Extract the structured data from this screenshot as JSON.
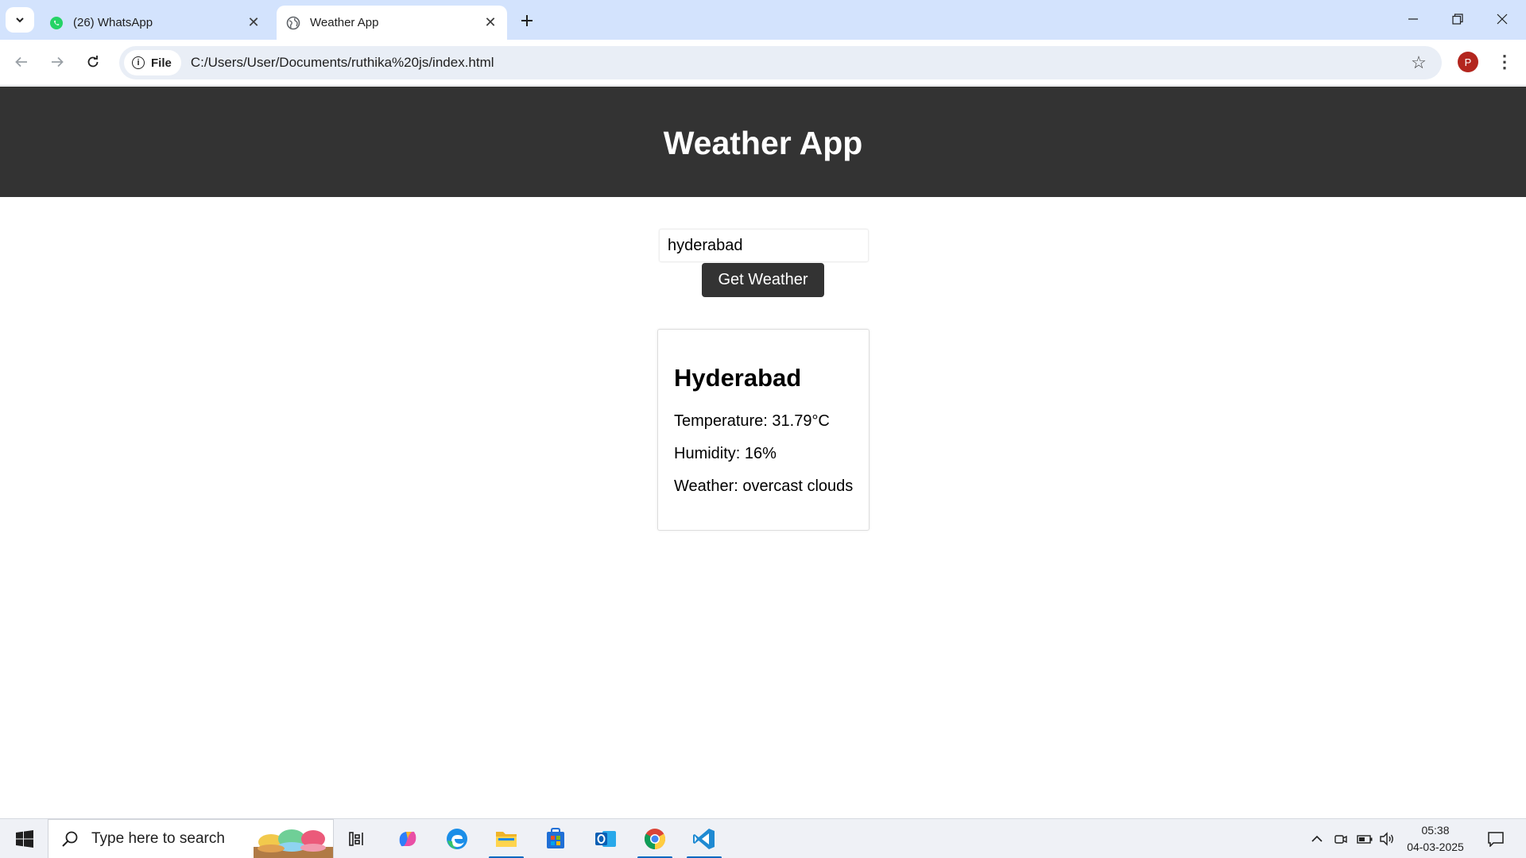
{
  "browser": {
    "tabs": [
      {
        "title": "(26) WhatsApp",
        "active": false,
        "icon": "whatsapp-icon"
      },
      {
        "title": "Weather App",
        "active": true,
        "icon": "globe-icon"
      }
    ],
    "address": {
      "chip_label": "File",
      "url": "C:/Users/User/Documents/ruthika%20js/index.html"
    },
    "profile_initial": "P"
  },
  "app": {
    "title": "Weather App",
    "search": {
      "value": "hyderabad"
    },
    "button_label": "Get Weather",
    "result": {
      "city": "Hyderabad",
      "temperature": "Temperature: 31.79°C",
      "humidity": "Humidity: 16%",
      "weather": "Weather: overcast clouds"
    }
  },
  "taskbar": {
    "search_placeholder": "Type here to search",
    "time": "05:38",
    "date": "04-03-2025",
    "accent_color": "#0067c0"
  }
}
